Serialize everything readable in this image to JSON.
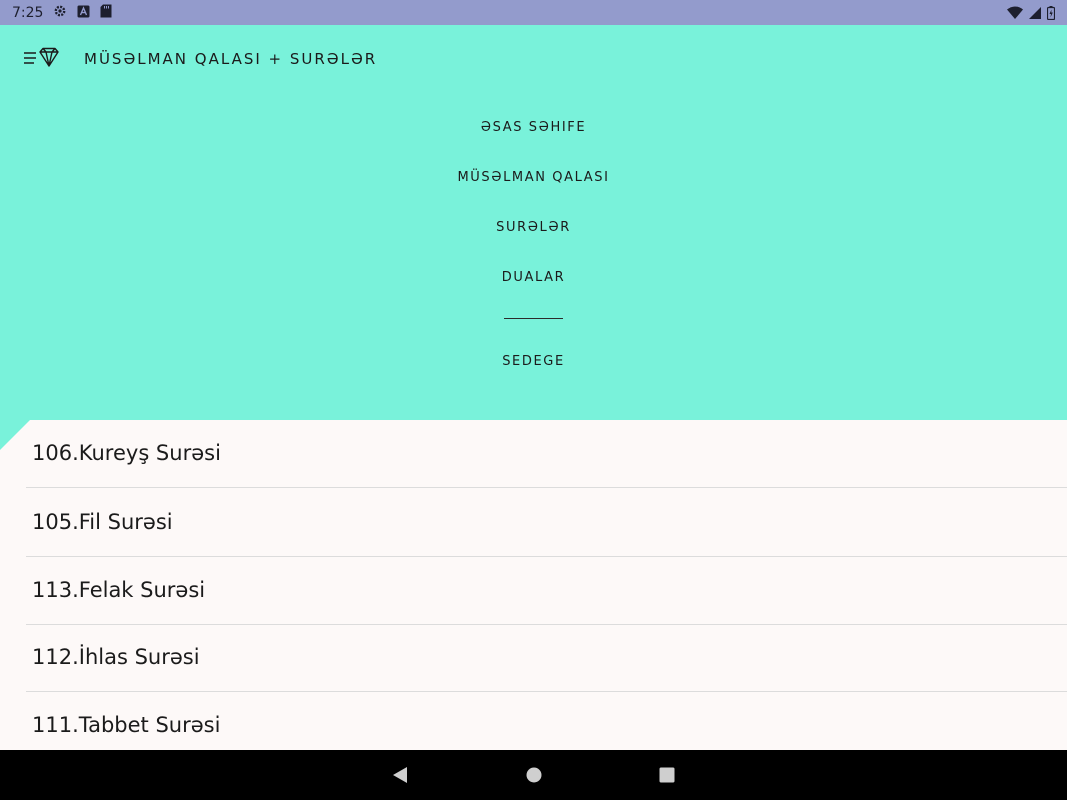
{
  "status_bar": {
    "time": "7:25",
    "left_icons": [
      "gear-icon",
      "a-box-icon",
      "sd-card-icon"
    ],
    "right_icons": [
      "wifi-icon",
      "signal-icon",
      "battery-icon"
    ]
  },
  "app_bar": {
    "title": "MÜSƏLMAN QALASI + SURƏLƏR",
    "menu_icon": "menu-diamond-icon"
  },
  "nav_menu": {
    "items": [
      {
        "label": "ƏSAS SƏHIFE"
      },
      {
        "label": "MÜSƏLMAN QALASI"
      },
      {
        "label": "SURƏLƏR"
      },
      {
        "label": "DUALAR"
      },
      {
        "label": "SEDEGE"
      }
    ]
  },
  "sura_list": {
    "items": [
      {
        "label": "106.Kureyş Surəsi"
      },
      {
        "label": "105.Fil Surəsi"
      },
      {
        "label": "113.Felak Surəsi"
      },
      {
        "label": "112.İhlas Surəsi"
      },
      {
        "label": "111.Tabbet Surəsi"
      }
    ]
  },
  "system_nav": {
    "icons": [
      "back-icon",
      "home-icon",
      "recents-icon"
    ]
  },
  "colors": {
    "accent": "#79f2da",
    "status_bar": "#939bcc",
    "surface": "#fdf9f8",
    "nav_bar": "#000000"
  }
}
